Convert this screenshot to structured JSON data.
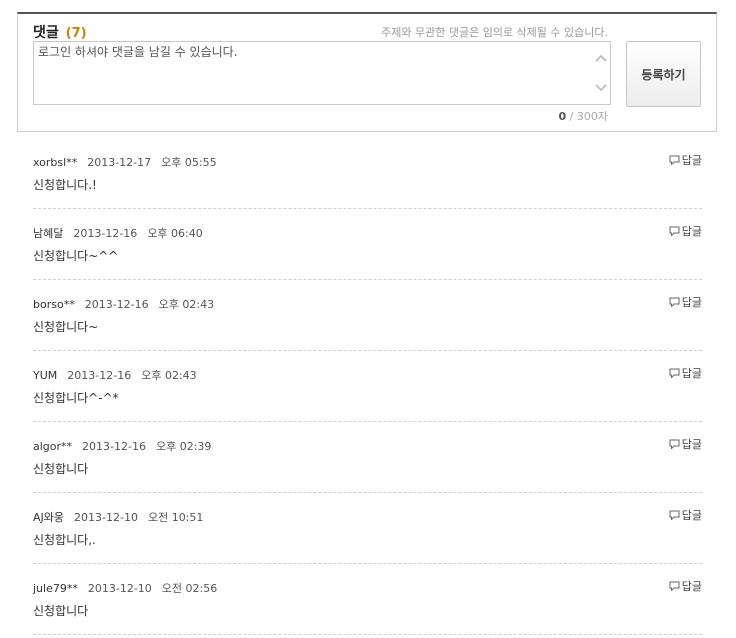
{
  "comment_form": {
    "title": "댓글",
    "count": "(7)",
    "notice": "주제와 무관한 댓글은 임의로 삭제될 수 있습니다.",
    "placeholder": "로그인 하셔야 댓글을 남길 수 있습니다.",
    "char_current": "0",
    "char_limit": "/ 300자",
    "submit_label": "등록하기"
  },
  "reply_label": "답글",
  "comments": [
    {
      "user": "xorbsl**",
      "date": "2013-12-17",
      "time": "오후 05:55",
      "text": "신청합니다.!"
    },
    {
      "user": "남혜달",
      "date": "2013-12-16",
      "time": "오후 06:40",
      "text": "신청합니다~^^"
    },
    {
      "user": "borso**",
      "date": "2013-12-16",
      "time": "오후 02:43",
      "text": "신청합니다~"
    },
    {
      "user": "YUM",
      "date": "2013-12-16",
      "time": "오후 02:43",
      "text": "신청합니다^-^*"
    },
    {
      "user": "algor**",
      "date": "2013-12-16",
      "time": "오후 02:39",
      "text": "신청합니다"
    },
    {
      "user": "AJ와웅",
      "date": "2013-12-10",
      "time": "오전 10:51",
      "text": "신청합니다,."
    },
    {
      "user": "jule79**",
      "date": "2013-12-10",
      "time": "오전 02:56",
      "text": "신청합니다"
    }
  ]
}
